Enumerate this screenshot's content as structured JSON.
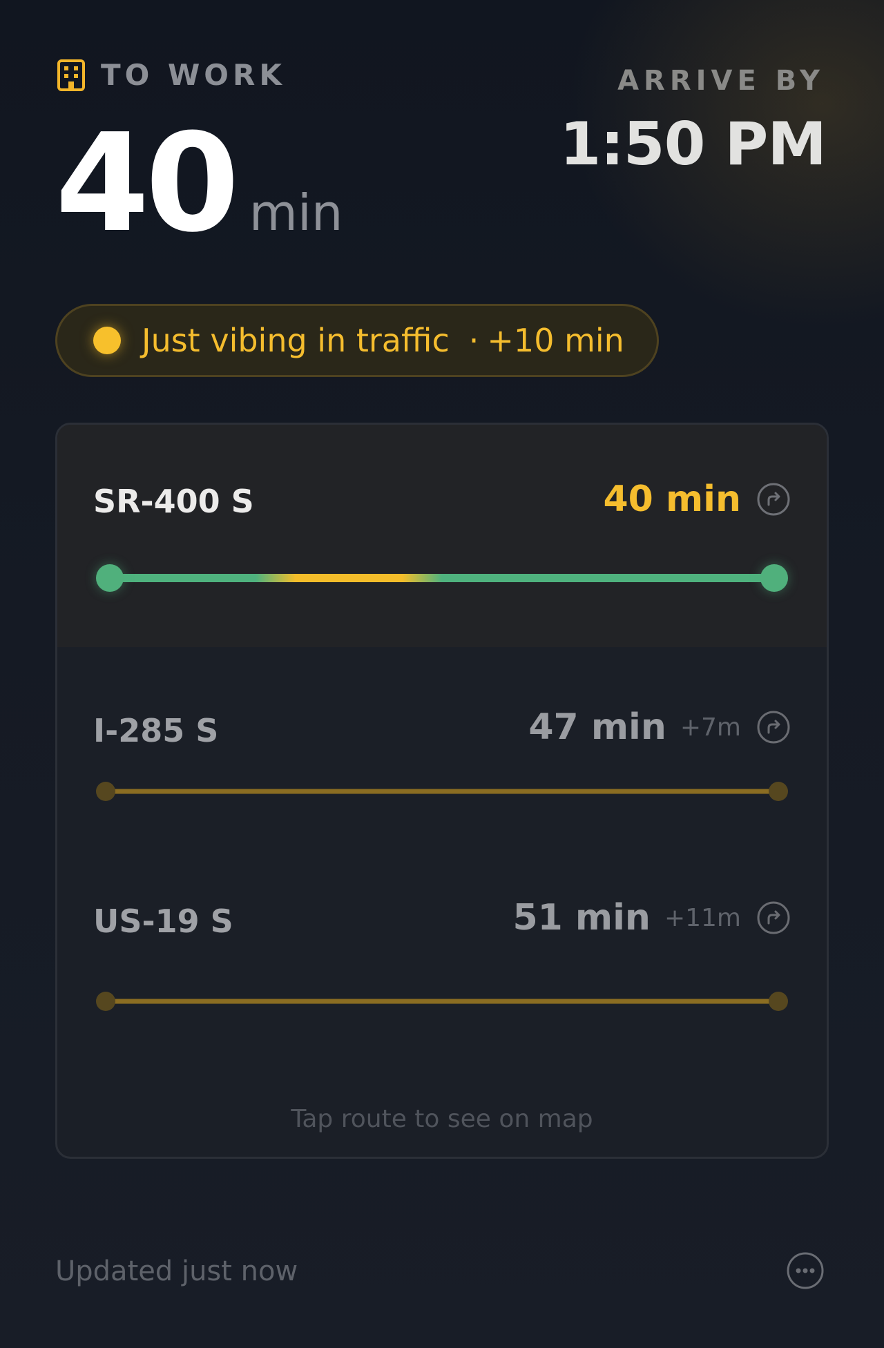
{
  "header": {
    "destination_label": "TO WORK",
    "destination_icon": "building-icon",
    "duration_value": "40",
    "duration_unit": "min",
    "arrive_label": "ARRIVE BY",
    "arrive_time": "1:50 PM"
  },
  "status": {
    "text": "Just vibing in traffic",
    "separator": "·",
    "delay": "+10 min",
    "color": "#f5bd2e"
  },
  "routes": [
    {
      "name": "SR-400 S",
      "time": "40 min",
      "delta": "",
      "selected": true,
      "icon": "turn-right-circle-icon",
      "traffic_color": "#4fb27e",
      "slow_color": "#f4bd2a"
    },
    {
      "name": "I-285 S",
      "time": "47 min",
      "delta": "+7m",
      "selected": false,
      "icon": "turn-right-circle-icon",
      "traffic_color": "#8b6d22"
    },
    {
      "name": "US-19 S",
      "time": "51 min",
      "delta": "+11m",
      "selected": false,
      "icon": "turn-right-circle-icon",
      "traffic_color": "#8b6d22"
    }
  ],
  "card_hint": "Tap route to see on map",
  "footer": {
    "updated_text": "Updated just now",
    "more_icon": "more-horizontal-icon"
  }
}
